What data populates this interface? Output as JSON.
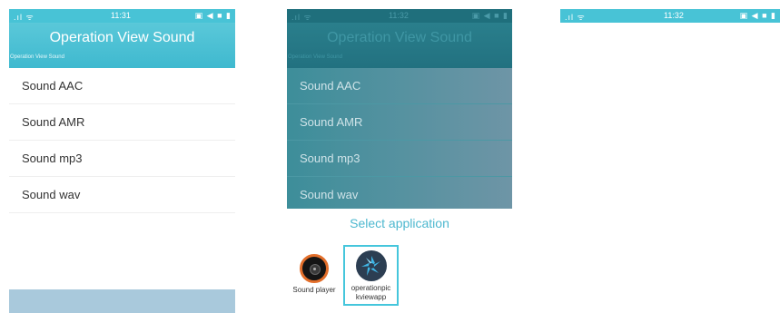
{
  "status": {
    "signal": "📶",
    "wifi": "ᯤ",
    "time": "11:31",
    "icons": "▣ ◀ ■ ▮"
  },
  "status2": {
    "time": "11:32"
  },
  "status3": {
    "time": "11:32"
  },
  "appbar": {
    "title": "Operation View Sound",
    "subtitle": "Operation View Sound"
  },
  "list": {
    "items": [
      {
        "label": "Sound AAC"
      },
      {
        "label": "Sound AMR"
      },
      {
        "label": "Sound mp3"
      },
      {
        "label": "Sound wav"
      }
    ]
  },
  "sheet": {
    "title": "Select application",
    "apps": [
      {
        "label": "Sound player",
        "icon": "vinyl-record-icon"
      },
      {
        "label": "operationpic kviewapp",
        "icon": "aperture-icon"
      }
    ]
  },
  "colors": {
    "accent": "#48c3d6",
    "sheet_title": "#4db8cf",
    "selection": "#45c6dc"
  }
}
